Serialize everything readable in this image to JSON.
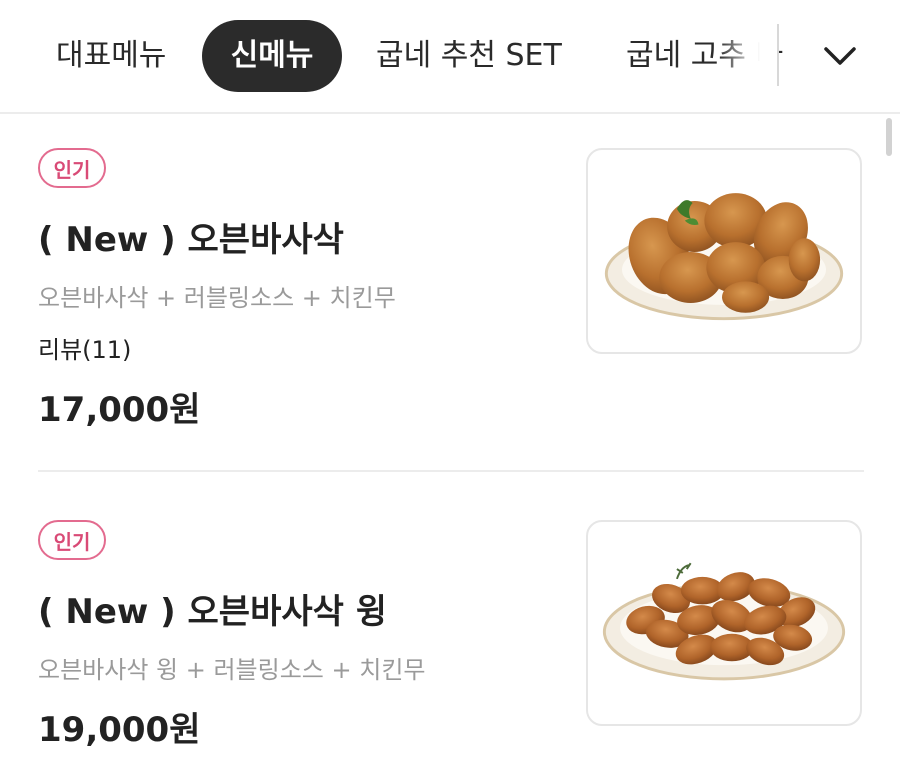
{
  "tabs": [
    {
      "label": "대표메뉴",
      "active": false
    },
    {
      "label": "신메뉴",
      "active": true
    },
    {
      "label": "굽네 추천 SET",
      "active": false
    },
    {
      "label": "굽네 고추 바",
      "active": false
    }
  ],
  "expand_icon": "chevron-down-icon",
  "items": [
    {
      "badge": "인기",
      "name": "( New ) 오븐바사삭",
      "description": "오븐바사삭 + 러블링소스 + 치킨무",
      "review": "리뷰(11)",
      "price": "17,000원",
      "image_icon": "chicken-plate-image"
    },
    {
      "badge": "인기",
      "name": "( New ) 오븐바사삭 윙",
      "description": "오븐바사삭 윙 + 러블링소스 + 치킨무",
      "price": "19,000원",
      "image_icon": "chicken-wings-plate-image"
    }
  ],
  "colors": {
    "active_tab_bg": "#2b2b2b",
    "badge_accent": "#e36b8f",
    "divider": "#ececec"
  }
}
